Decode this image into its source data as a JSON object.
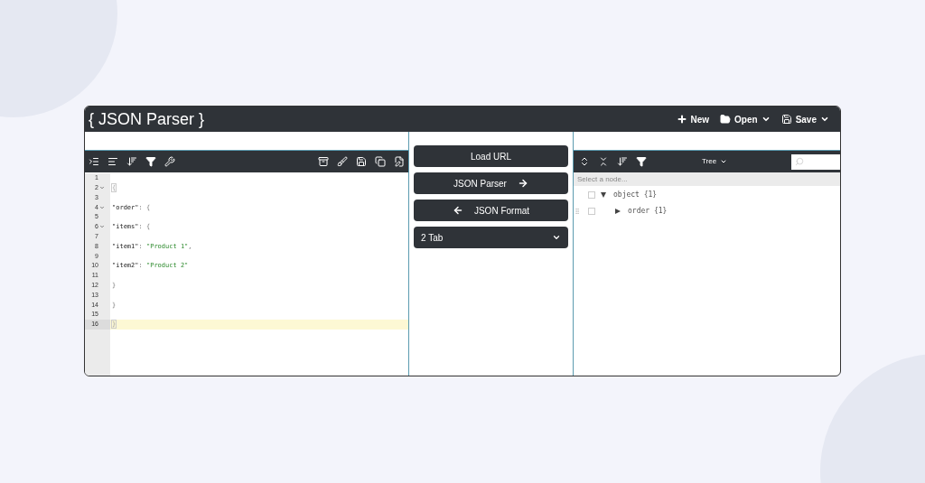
{
  "window": {
    "title": "{ JSON Parser }"
  },
  "header_menu": [
    {
      "kind": "new",
      "label": "New",
      "dropdown": false
    },
    {
      "kind": "open",
      "label": "Open",
      "dropdown": true
    },
    {
      "kind": "save",
      "label": "Save",
      "dropdown": true
    }
  ],
  "editor": {
    "lines": [
      {
        "number": "1",
        "fold": false,
        "active": false
      },
      {
        "number": "2",
        "fold": true,
        "active": false,
        "tokens": [
          {
            "kind": "bracket-match",
            "text": "{"
          }
        ]
      },
      {
        "number": "3",
        "fold": false,
        "active": false
      },
      {
        "number": "4",
        "fold": true,
        "active": false,
        "tokens": [
          {
            "kind": "key",
            "text": "\"order\""
          },
          {
            "kind": "punct",
            "text": ": {"
          }
        ]
      },
      {
        "number": "5",
        "fold": false,
        "active": false
      },
      {
        "number": "6",
        "fold": true,
        "active": false,
        "tokens": [
          {
            "kind": "key",
            "text": "\"items\""
          },
          {
            "kind": "punct",
            "text": ": {"
          }
        ]
      },
      {
        "number": "7",
        "fold": false,
        "active": false
      },
      {
        "number": "8",
        "fold": false,
        "active": false,
        "tokens": [
          {
            "kind": "key",
            "text": "\"item1\""
          },
          {
            "kind": "punct",
            "text": ": "
          },
          {
            "kind": "string",
            "text": "\"Product 1\""
          },
          {
            "kind": "punct",
            "text": ","
          }
        ]
      },
      {
        "number": "9",
        "fold": false,
        "active": false
      },
      {
        "number": "10",
        "fold": false,
        "active": false,
        "tokens": [
          {
            "kind": "key",
            "text": "\"item2\""
          },
          {
            "kind": "punct",
            "text": ": "
          },
          {
            "kind": "string",
            "text": "\"Product 2\""
          }
        ]
      },
      {
        "number": "11",
        "fold": false,
        "active": false
      },
      {
        "number": "12",
        "fold": false,
        "active": false,
        "tokens": [
          {
            "kind": "punct",
            "text": "}"
          }
        ]
      },
      {
        "number": "13",
        "fold": false,
        "active": false
      },
      {
        "number": "14",
        "fold": false,
        "active": false,
        "tokens": [
          {
            "kind": "punct",
            "text": "}"
          }
        ]
      },
      {
        "number": "15",
        "fold": false,
        "active": false
      },
      {
        "number": "16",
        "fold": false,
        "active": true,
        "tokens": [
          {
            "kind": "bracket-match",
            "text": "}"
          }
        ]
      }
    ]
  },
  "actions": [
    {
      "kind": "plain",
      "label": "Load URL"
    },
    {
      "kind": "arrow-right",
      "label": "JSON Parser"
    },
    {
      "kind": "arrow-left",
      "label": "JSON Format"
    }
  ],
  "indent_select": {
    "value": "2 Tab"
  },
  "tree_view": {
    "mode": "Tree",
    "status": "Select a node...",
    "nodes": [
      {
        "label": "object {1}",
        "checked": false,
        "expanded": true,
        "children": [
          {
            "label": "order {1}",
            "checked": false,
            "expanded": false
          }
        ]
      }
    ]
  }
}
